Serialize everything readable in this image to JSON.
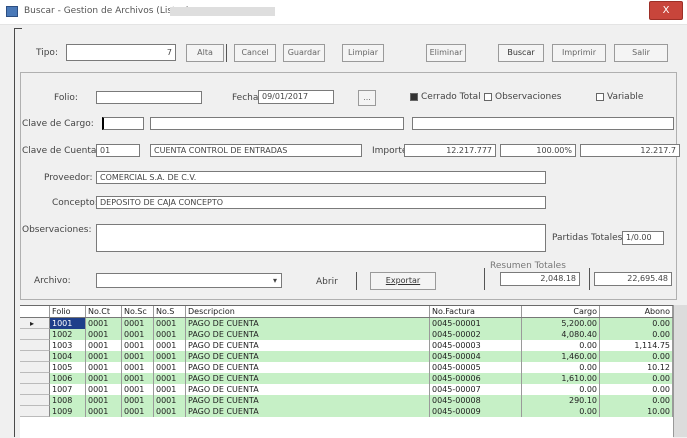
{
  "window": {
    "title": "Buscar - Gestion de Archivos (Listas)",
    "close_label": "X"
  },
  "toolbar": {
    "tipo_label": "Tipo:",
    "tipo_value": "",
    "tipo_num": "7",
    "buttons": [
      "Alta",
      "Cancel",
      "Guardar",
      "Limpiar",
      "Eliminar",
      "Buscar",
      "Imprimir",
      "Salir"
    ]
  },
  "form": {
    "folio_label": "Folio:",
    "folio_value": "",
    "fecha_label": "Fecha:",
    "fecha_value": "09/01/2017",
    "fecha_btn": "...",
    "checks": [
      {
        "label": "Cerrado Total",
        "checked": true
      },
      {
        "label": "Observaciones",
        "checked": false
      },
      {
        "label": "Variable",
        "checked": false
      }
    ],
    "cliente_label": "Clave de Cargo:",
    "cliente_code": "",
    "cliente_name": "",
    "cliente_extra": "",
    "cuenta_label": "Clave de Cuenta:",
    "cuenta_code": "01",
    "cuenta_name": "CUENTA CONTROL DE ENTRADAS",
    "importe_label": "Importe:",
    "importe_value": "12.217.777",
    "porcentaje_value": "100.00%",
    "importe_total": "12.217.7",
    "proveedor_label": "Proveedor:",
    "proveedor_value": "COMERCIAL S.A. DE C.V.",
    "concepto_label": "Concepto:",
    "concepto_value": "DEPOSITO DE CAJA CONCEPTO",
    "observaciones_label": "Observaciones:",
    "observaciones_value": "",
    "partidas_label": "Partidas Totales:",
    "partidas_value": "1/0.00",
    "archivo_label": "Archivo:",
    "archivo_value": "",
    "buscar_label": "Abrir",
    "exportar_label": "Exportar",
    "resumen_label": "Resumen Totales",
    "resumen_cargo": "2,048.18",
    "resumen_abono": "22,695.48"
  },
  "grid": {
    "columns": [
      "Folio",
      "No.Ct",
      "No.Sc",
      "No.S",
      "Descripcion",
      "No.Factura",
      "Cargo",
      "Abono"
    ],
    "rows": [
      {
        "style": "green",
        "selected": true,
        "cells": [
          "1001",
          "0001",
          "0001",
          "0001",
          "PAGO DE CUENTA",
          "0045-00001",
          "5,200.00",
          "0.00"
        ]
      },
      {
        "style": "green",
        "cells": [
          "1002",
          "0001",
          "0001",
          "0001",
          "PAGO DE CUENTA",
          "0045-00002",
          "4,080.40",
          "0.00"
        ]
      },
      {
        "style": "white",
        "cells": [
          "1003",
          "0001",
          "0001",
          "0001",
          "PAGO DE CUENTA",
          "0045-00003",
          "0.00",
          "1,114.75"
        ]
      },
      {
        "style": "green",
        "cells": [
          "1004",
          "0001",
          "0001",
          "0001",
          "PAGO DE CUENTA",
          "0045-00004",
          "1,460.00",
          "0.00"
        ]
      },
      {
        "style": "white",
        "cells": [
          "1005",
          "0001",
          "0001",
          "0001",
          "PAGO DE CUENTA",
          "0045-00005",
          "0.00",
          "10.12"
        ]
      },
      {
        "style": "green",
        "cells": [
          "1006",
          "0001",
          "0001",
          "0001",
          "PAGO DE CUENTA",
          "0045-00006",
          "1,610.00",
          "0.00"
        ]
      },
      {
        "style": "white",
        "cells": [
          "1007",
          "0001",
          "0001",
          "0001",
          "PAGO DE CUENTA",
          "0045-00007",
          "0.00",
          "0.00"
        ]
      },
      {
        "style": "green",
        "cells": [
          "1008",
          "0001",
          "0001",
          "0001",
          "PAGO DE CUENTA",
          "0045-00008",
          "290.10",
          "0.00"
        ]
      },
      {
        "style": "green",
        "cells": [
          "1009",
          "0001",
          "0001",
          "0001",
          "PAGO DE CUENTA",
          "0045-00009",
          "0.00",
          "10.00"
        ]
      }
    ]
  }
}
